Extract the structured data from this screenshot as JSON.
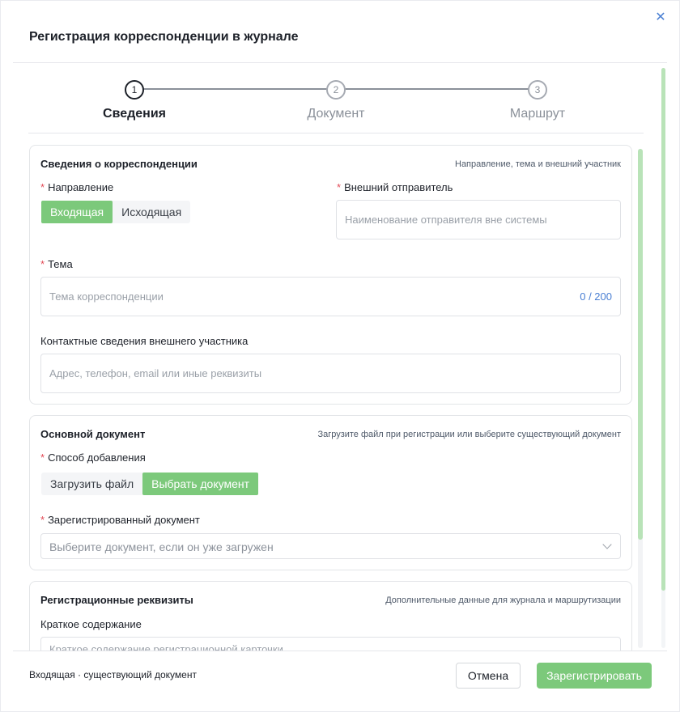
{
  "dialog": {
    "title": "Регистрация корреспонденции в журнале",
    "close_icon": "close-icon"
  },
  "steps": [
    {
      "number": "1",
      "label": "Сведения",
      "active": true
    },
    {
      "number": "2",
      "label": "Документ",
      "active": false
    },
    {
      "number": "3",
      "label": "Маршрут",
      "active": false
    }
  ],
  "card_info": {
    "title": "Сведения о корреспонденции",
    "hint": "Направление, тема и внешний участник",
    "direction": {
      "label": "Направление",
      "required": "*",
      "options": [
        "Входящая",
        "Исходящая"
      ],
      "selected": "Входящая"
    },
    "sender": {
      "label": "Внешний отправитель",
      "required": "*",
      "placeholder": "Наименование отправителя вне системы"
    },
    "subject": {
      "label": "Тема",
      "required": "*",
      "placeholder": "Тема корреспонденции",
      "counter": "0 / 200"
    },
    "contacts": {
      "label": "Контактные сведения внешнего участника",
      "placeholder": "Адрес, телефон, email или иные реквизиты"
    }
  },
  "card_doc": {
    "title": "Основной документ",
    "hint": "Загрузите файл при регистрации или выберите существующий документ",
    "method": {
      "label": "Способ добавления",
      "required": "*",
      "options": [
        "Загрузить файл",
        "Выбрать документ"
      ],
      "selected": "Выбрать документ"
    },
    "registered": {
      "label": "Зарегистрированный документ",
      "required": "*",
      "placeholder": "Выберите документ, если он уже загружен"
    }
  },
  "card_req": {
    "title": "Регистрационные реквизиты",
    "hint": "Дополнительные данные для журнала и маршрутизации",
    "summary": {
      "label": "Краткое содержание",
      "placeholder": "Краткое содержание регистрационной карточки"
    }
  },
  "footer": {
    "status": "Входящая · существующий документ",
    "cancel_label": "Отмена",
    "submit_label": "Зарегистрировать"
  },
  "colors": {
    "accent": "#7cc97b",
    "link": "#4a7fd3",
    "required": "#e34d59"
  }
}
